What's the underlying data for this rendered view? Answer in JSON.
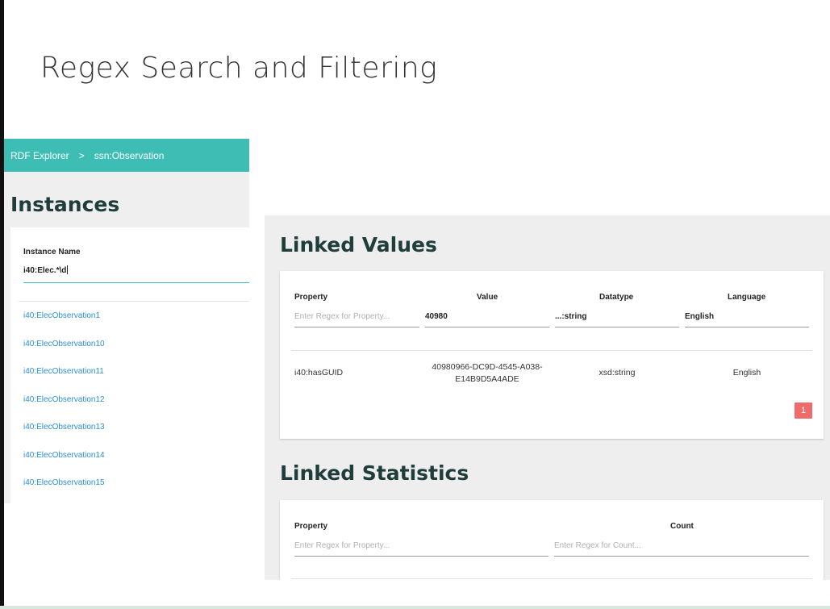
{
  "slide": {
    "title": "Regex Search and Filtering"
  },
  "left_panel": {
    "breadcrumb": {
      "root": "RDF Explorer",
      "separator": ">",
      "current": "ssn:Observation"
    },
    "heading": "Instances",
    "filter": {
      "label": "Instance Name",
      "value": "i40:Elec.*\\d"
    },
    "instances": [
      "i40:ElecObservation1",
      "i40:ElecObservation10",
      "i40:ElecObservation11",
      "i40:ElecObservation12",
      "i40:ElecObservation13",
      "i40:ElecObservation14",
      "i40:ElecObservation15"
    ]
  },
  "linked_values": {
    "heading": "Linked Values",
    "columns": {
      "property": "Property",
      "value": "Value",
      "datatype": "Datatype",
      "language": "Language"
    },
    "filters": {
      "property_placeholder": "Enter Regex for Property...",
      "value": "40980",
      "datatype": "...:string",
      "language": "English"
    },
    "rows": [
      {
        "property": "i40:hasGUID",
        "value_line1": "40980966-DC9D-4545-A038-",
        "value_line2": "E14B9D5A4ADE",
        "datatype": "xsd:string",
        "language": "English"
      }
    ],
    "pagination": {
      "current_page": "1"
    }
  },
  "linked_statistics": {
    "heading": "Linked Statistics",
    "columns": {
      "property": "Property",
      "count": "Count"
    },
    "filters": {
      "property_placeholder": "Enter Regex for Property...",
      "count_placeholder": "Enter Regex for Count..."
    }
  },
  "colors": {
    "accent_teal": "#3ebdb5",
    "heading_dark": "#1e3d3b",
    "link_blue": "#2c8fd6",
    "page_badge_red": "#f06b6b"
  }
}
